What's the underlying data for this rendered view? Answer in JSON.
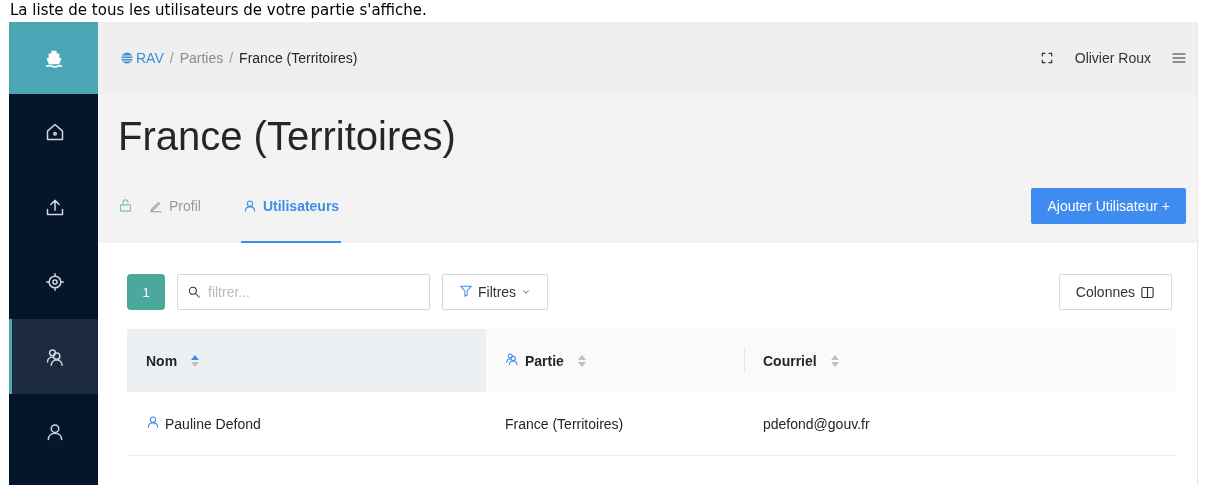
{
  "caption": "La liste de tous les utilisateurs de votre partie s'affiche.",
  "sidebar": {
    "items": [
      {
        "selected": false
      },
      {
        "selected": false
      },
      {
        "selected": false
      },
      {
        "selected": true
      },
      {
        "selected": false
      }
    ]
  },
  "breadcrumb_separator": "/",
  "breadcrumb": [
    {
      "label": "RAV",
      "kind": "logo"
    },
    {
      "label": "Parties",
      "kind": "link"
    },
    {
      "label": "France (Territoires)",
      "kind": "current"
    }
  ],
  "user_name": "Olivier Roux",
  "title": "France (Territoires)",
  "tabs": [
    {
      "label": "Profil",
      "selected": false
    },
    {
      "label": "Utilisateurs",
      "selected": true
    }
  ],
  "add_button": "Ajouter Utilisateur +",
  "count": "1",
  "search": {
    "placeholder": "filtrer..."
  },
  "filter_button": "Filtres",
  "columns_button": "Colonnes",
  "table": {
    "columns": [
      {
        "label": "Nom",
        "sorted": true
      },
      {
        "label": "Partie",
        "sorted": false
      },
      {
        "label": "Courriel",
        "sorted": false
      }
    ],
    "rows": [
      [
        "Pauline Defond",
        "France (Territoires)",
        "pdefond@gouv.fr"
      ]
    ]
  }
}
